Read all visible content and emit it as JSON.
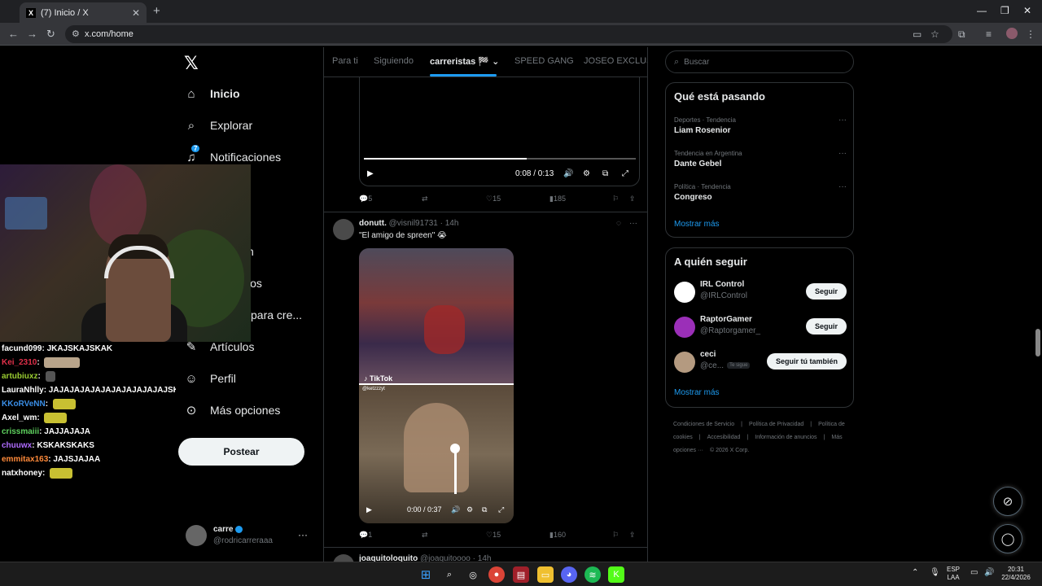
{
  "browser": {
    "tab_title": "(7) Inicio / X",
    "url": "x.com/home",
    "tab_close": "✕",
    "new_tab": "+"
  },
  "nav": {
    "logo": "𝕏",
    "items": [
      {
        "label": "Inicio",
        "icon": "home-icon"
      },
      {
        "label": "Explorar",
        "icon": "search-icon"
      },
      {
        "label": "Notificaciones",
        "icon": "bell-icon",
        "badge": "7"
      },
      {
        "label": "n",
        "icon": "partial"
      },
      {
        "label": "los",
        "icon": "partial"
      },
      {
        "label": "para cre...",
        "icon": "partial"
      },
      {
        "label": "Artículos",
        "icon": "article-icon"
      },
      {
        "label": "Perfil",
        "icon": "person-icon"
      },
      {
        "label": "Más opciones",
        "icon": "more-icon"
      }
    ],
    "post_button": "Postear",
    "account": {
      "name": "carre",
      "handle": "@rodricarreraaa"
    }
  },
  "chat": [
    {
      "user": "facund099",
      "color": "#ffffff",
      "msg": "JKAJSKAJSKAK",
      "emote": ""
    },
    {
      "user": "Kei_2310",
      "color": "#e0304a",
      "msg": "",
      "emote": "gray"
    },
    {
      "user": "artubiuxz",
      "color": "#9acd32",
      "msg": "",
      "emote": "mute"
    },
    {
      "user": "LauraNhlly",
      "color": "#ffffff",
      "msg": "JAJAJAJAJAJAJAJAJAJAJAJSK",
      "emote": ""
    },
    {
      "user": "KKoRVeNN",
      "color": "#3a8ee6",
      "msg": "",
      "emote": "yellow"
    },
    {
      "user": "Axel_wm",
      "color": "#ffffff",
      "msg": "",
      "emote": "yellow"
    },
    {
      "user": "crissmaiii",
      "color": "#5fd35f",
      "msg": "JAJJAJAJA",
      "emote": ""
    },
    {
      "user": "chuuwx",
      "color": "#b06cff",
      "msg": "KSKAKSKAKS",
      "emote": ""
    },
    {
      "user": "emmitax163",
      "color": "#ff8a3a",
      "msg": "JAJSJAJAA",
      "emote": ""
    },
    {
      "user": "natxhoney",
      "color": "#ffffff",
      "msg": "",
      "emote": "yellow"
    }
  ],
  "feed": {
    "tabs": [
      "Para ti",
      "Siguiendo",
      "carreristas 🏁",
      "SPEED GANG",
      "JOSEO EXCLUSIV"
    ],
    "video1": {
      "time": "0:08 / 0:13",
      "progress": 0.6
    },
    "tweet1_stats": {
      "replies": "5",
      "likes": "15",
      "views": "185"
    },
    "tweet2": {
      "name": "donutt.",
      "handle": "@visnil91731",
      "time": "14h",
      "text": "\"El amigo de spreen\" 😭",
      "video_time": "0:00 / 0:37",
      "tiktok": "TikTok",
      "tiktok_handle": "@ketzzzyt"
    },
    "tweet2_stats": {
      "replies": "1",
      "likes": "15",
      "views": "160"
    },
    "tweet3_peek": {
      "name": "joaquitoloquito",
      "handle": "@joaquitoooo",
      "time": "14h"
    }
  },
  "sidebar": {
    "search_placeholder": "Buscar",
    "trends_title": "Qué está pasando",
    "trends": [
      {
        "category": "Deportes · Tendencia",
        "name": "Liam Rosenior"
      },
      {
        "category": "Tendencia en Argentina",
        "name": "Dante Gebel"
      },
      {
        "category": "Política · Tendencia",
        "name": "Congreso"
      }
    ],
    "show_more": "Mostrar más",
    "who_title": "A quién seguir",
    "who": [
      {
        "name": "IRL Control",
        "handle": "@IRLControl",
        "button": "Seguir",
        "avatar_color": "#ffffff"
      },
      {
        "name": "RaptorGamer",
        "handle": "@Raptorgamer_",
        "button": "Seguir",
        "avatar_color": "#9b2fb8"
      },
      {
        "name": "ceci",
        "handle": "@ce...",
        "follows_you": "Te sigue",
        "button": "Seguir tú también",
        "avatar_color": "#b49a80"
      }
    ],
    "footer": [
      "Condiciones de Servicio",
      "|",
      "Política de Privacidad",
      "|",
      "Política de cookies",
      "|",
      "Accesibilidad",
      "|",
      "Información de anuncios",
      "|",
      "Más opciones ···",
      "© 2026 X Corp."
    ]
  },
  "taskbar": {
    "lang": "ESP",
    "lang2": "LAA",
    "time": "20:31",
    "date": "22/4/2026"
  },
  "colors": {
    "accent": "#1d9bf0",
    "bg": "#000000",
    "border": "#2f3336"
  }
}
